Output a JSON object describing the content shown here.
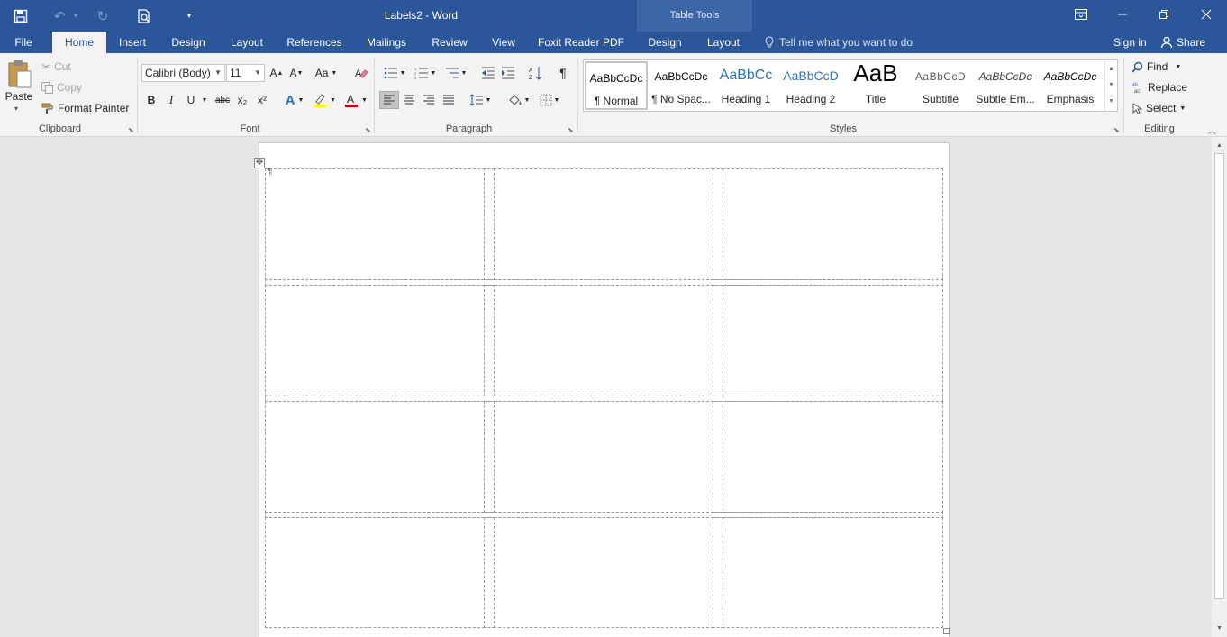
{
  "window": {
    "title": "Labels2 - Word",
    "context_title": "Table Tools",
    "sign_in": "Sign in",
    "share": "Share"
  },
  "tabs": [
    "File",
    "Home",
    "Insert",
    "Design",
    "Layout",
    "References",
    "Mailings",
    "Review",
    "View",
    "Foxit Reader PDF",
    "Design",
    "Layout"
  ],
  "active_tab": "Home",
  "tell_me": "Tell me what you want to do",
  "clipboard": {
    "paste": "Paste",
    "cut": "Cut",
    "copy": "Copy",
    "format_painter": "Format Painter",
    "group": "Clipboard"
  },
  "font": {
    "name": "Calibri (Body)",
    "size": "11",
    "change_case": "Aa",
    "bold": "B",
    "italic": "I",
    "underline": "U",
    "strikethrough": "abc",
    "subscript": "x₂",
    "superscript": "x²",
    "group": "Font"
  },
  "paragraph": {
    "group": "Paragraph"
  },
  "styles": {
    "group": "Styles",
    "items": [
      {
        "sample": "AaBbCcDc",
        "name": "¶ Normal"
      },
      {
        "sample": "AaBbCcDc",
        "name": "¶ No Spac..."
      },
      {
        "sample": "AaBbCc",
        "name": "Heading 1"
      },
      {
        "sample": "AaBbCcD",
        "name": "Heading 2"
      },
      {
        "sample": "AaB",
        "name": "Title"
      },
      {
        "sample": "AaBbCcD",
        "name": "Subtitle"
      },
      {
        "sample": "AaBbCcDc",
        "name": "Subtle Em..."
      },
      {
        "sample": "AaBbCcDc",
        "name": "Emphasis"
      }
    ]
  },
  "editing": {
    "find": "Find",
    "replace": "Replace",
    "select": "Select",
    "group": "Editing"
  },
  "document": {
    "rows": 4,
    "columns": 3,
    "paragraph_mark": "¶"
  },
  "colors": {
    "title_bar": "#2b579a",
    "ribbon": "#f3f3f3",
    "workspace": "#e6e6e6",
    "font_color": "#c00000",
    "highlight": "#ffff00"
  }
}
